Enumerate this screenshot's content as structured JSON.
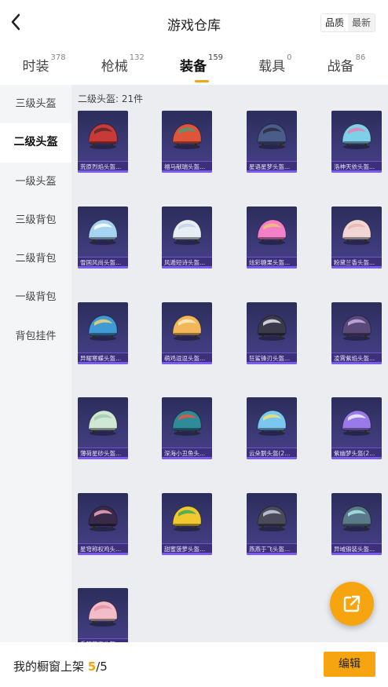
{
  "header": {
    "title": "游戏仓库",
    "sort_options": [
      "品质",
      "最新"
    ],
    "sort_active": "品质"
  },
  "tabs": [
    {
      "label": "时装",
      "count": "378"
    },
    {
      "label": "枪械",
      "count": "132"
    },
    {
      "label": "装备",
      "count": "159",
      "active": true
    },
    {
      "label": "载具",
      "count": "0"
    },
    {
      "label": "战备",
      "count": "86"
    }
  ],
  "sidebar": {
    "items": [
      "三级头盔",
      "二级头盔",
      "一级头盔",
      "三级背包",
      "二级背包",
      "一级背包",
      "背包挂件"
    ],
    "active_index": 1
  },
  "section": {
    "label": "二级头盔: 21件"
  },
  "items": [
    {
      "name": "荒原烈焰头盔...",
      "colors": [
        "#c83a3a",
        "#5a2a2a"
      ]
    },
    {
      "name": "福马献瑞头盔...",
      "colors": [
        "#e0553a",
        "#3fa27a"
      ]
    },
    {
      "name": "星语星梦头盔...",
      "colors": [
        "#4a5d8a",
        "#2a2a3e"
      ]
    },
    {
      "name": "洛神天依头盔...",
      "colors": [
        "#7fcfe8",
        "#e87fb0"
      ]
    },
    {
      "name": "雪国风尚头盔...",
      "colors": [
        "#a7d3f2",
        "#ffffff"
      ]
    },
    {
      "name": "风遁短诗头盔...",
      "colors": [
        "#e8eef5",
        "#c6d3e6"
      ]
    },
    {
      "name": "炫彩糖果头盔...",
      "colors": [
        "#f27fc7",
        "#f2c26e"
      ]
    },
    {
      "name": "粉黛兰香头盔...",
      "colors": [
        "#f2d6d6",
        "#e8b7b7"
      ]
    },
    {
      "name": "异曜寒蝶头盔...",
      "colors": [
        "#3f9ad6",
        "#f2d56e"
      ]
    },
    {
      "name": "萌鸡逗逗头盔...",
      "colors": [
        "#f2b75a",
        "#fff0c6"
      ]
    },
    {
      "name": "狂鲨锋刃头盔...",
      "colors": [
        "#3a3a4a",
        "#e8e8f0"
      ]
    },
    {
      "name": "凌霄紫焰头盔...",
      "colors": [
        "#5a4a7a",
        "#c8b0e8"
      ]
    },
    {
      "name": "薄荷星砂头盔...",
      "colors": [
        "#cfe8d6",
        "#a6c9b3"
      ]
    },
    {
      "name": "深海小丑鱼头...",
      "colors": [
        "#2f8a9a",
        "#e25a3a"
      ]
    },
    {
      "name": "云朵鹅头盔(2...",
      "colors": [
        "#7ac8f0",
        "#f2e06e"
      ]
    },
    {
      "name": "紫幽梦头盔(2...",
      "colors": [
        "#9a7ae8",
        "#f2f2ff"
      ]
    },
    {
      "name": "星穹称权鸡头...",
      "colors": [
        "#3a2a4a",
        "#f2a6c0"
      ]
    },
    {
      "name": "甜蜜菠萝头盔...",
      "colors": [
        "#f2c830",
        "#3aa85a"
      ]
    },
    {
      "name": "燕燕于飞头盔...",
      "colors": [
        "#4a4a5a",
        "#c8d0e8"
      ]
    },
    {
      "name": "异域锻装头盔...",
      "colors": [
        "#5a7a8a",
        "#a8e8e8"
      ]
    },
    {
      "name": "香辣花海头盔...",
      "colors": [
        "#f2bcc8",
        "#e890a6"
      ]
    }
  ],
  "footer": {
    "label": "我的橱窗上架",
    "current": "5",
    "total": "/5",
    "edit_label": "编辑"
  },
  "colors": {
    "accent": "#f6a510",
    "card_bg": "#3c3a78"
  },
  "icons": {
    "back": "chevron-left-icon",
    "share": "share-external-icon"
  }
}
